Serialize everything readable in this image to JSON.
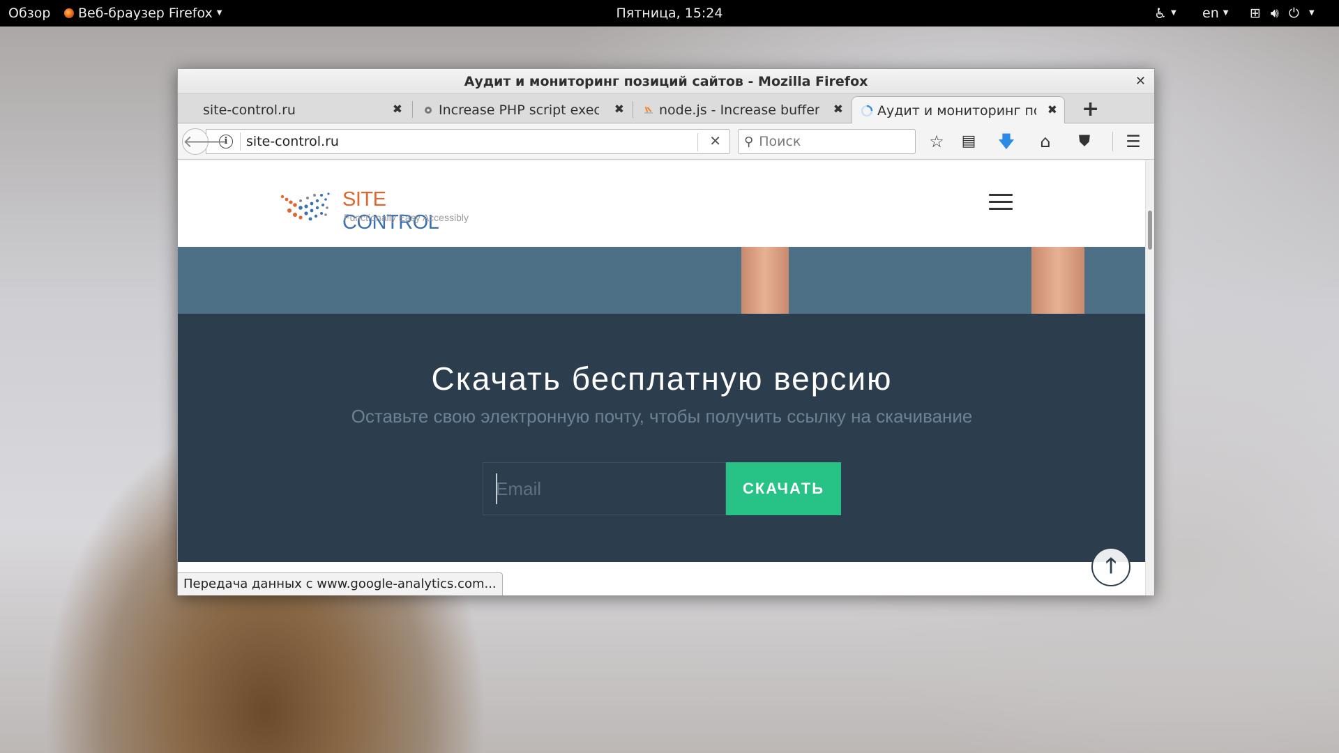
{
  "topbar": {
    "overview": "Обзор",
    "app": "Веб-браузер Firefox",
    "clock": "Пятница, 15:24",
    "lang": "en"
  },
  "window": {
    "title": "Аудит и мониторинг позиций сайтов - Mozilla Firefox"
  },
  "tabs": [
    {
      "label": "site-control.ru",
      "active": false
    },
    {
      "label": "Increase PHP script execu",
      "active": false
    },
    {
      "label": "node.js - Increase buffer t",
      "active": false
    },
    {
      "label": "Аудит и мониторинг поз",
      "active": true
    }
  ],
  "navbar": {
    "url": "site-control.ru",
    "search_placeholder": "Поиск"
  },
  "site": {
    "logo_site": "SITE",
    "logo_control": "CONTROL",
    "logo_tagline": "Functionally Easy Accessibly",
    "download_title": "Скачать бесплатную версию",
    "download_subtitle": "Оставьте свою электронную почту, чтобы получить ссылку на скачивание",
    "email_placeholder": "Email",
    "download_button": "СКАЧАТЬ"
  },
  "status": "Передача данных с www.google-analytics.com..."
}
